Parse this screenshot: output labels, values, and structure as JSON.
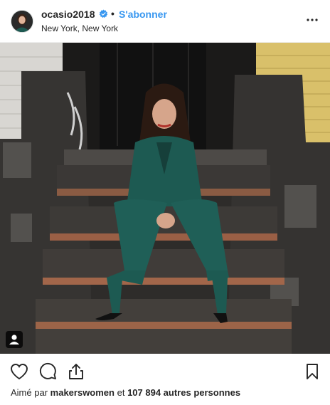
{
  "post": {
    "username": "ocasio2018",
    "separator": "•",
    "follow_label": "S'abonner",
    "location": "New York, New York"
  },
  "icons": {
    "verified": "verified-badge-icon",
    "more": "more-options-icon",
    "like": "heart-icon",
    "comment": "comment-icon",
    "share": "share-icon",
    "save": "bookmark-icon",
    "user_tag": "user-tag-icon"
  },
  "likes": {
    "prefix": "Aimé par",
    "first_user": "makerswomen",
    "connector": "et",
    "others": "107 894 autres personnes"
  },
  "colors": {
    "accent": "#3897f0",
    "text": "#262626",
    "suit": "#1d5a52",
    "wall_yellow": "#d9c06a"
  }
}
